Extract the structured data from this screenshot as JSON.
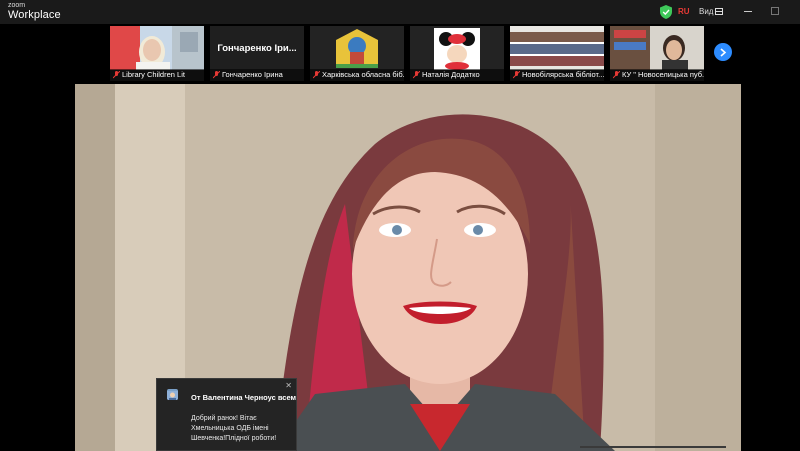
{
  "app": {
    "brand_small": "zoom",
    "brand_large": "Workplace"
  },
  "titlebar": {
    "language": "RU",
    "view_label": "Вид"
  },
  "colors": {
    "accent": "#2d8cff",
    "mic_muted": "#e53935",
    "security": "#3ec85a"
  },
  "participants": [
    {
      "label": "Library Children Lit",
      "muted": true
    },
    {
      "display_name": "Гончаренко Іри...",
      "label": "Гончаренко Ірина",
      "muted": true
    },
    {
      "label": "Харківська обласна біб...",
      "muted": true
    },
    {
      "label": "Наталія Додатко",
      "muted": true
    },
    {
      "label": "Новобілярська бібліот...",
      "muted": true
    },
    {
      "label": "КУ \" Новоселицька пуб...",
      "muted": true
    }
  ],
  "chat": {
    "from": "От Валентина Черноус всем",
    "message": "Добрий ранок! Вітає Хмельницька ОДБ імені Шевченка!Плідної роботи!",
    "close_icon": "close-icon"
  }
}
